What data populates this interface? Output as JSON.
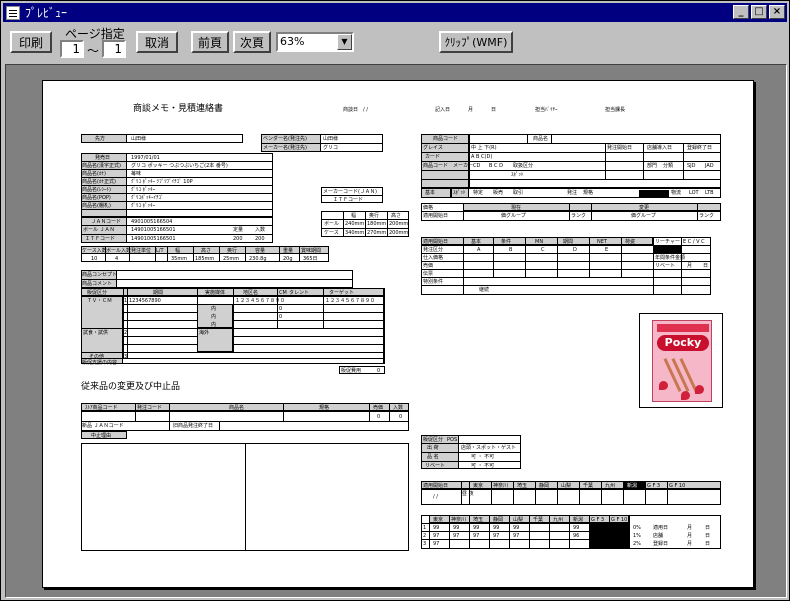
{
  "window": {
    "title": "ﾌﾟﾚﾋﾞｭｰ",
    "min": "_",
    "max": "□",
    "close": "×"
  },
  "toolbar": {
    "print": "印刷",
    "page_select_label": "ページ指定",
    "page_from": "1",
    "page_sep": "～",
    "page_to": "1",
    "cancel": "取消",
    "prev": "前頁",
    "next": "次頁",
    "zoom": "63%",
    "clip": "ｸﾘｯﾌﾟ(WMF)"
  },
  "doc": {
    "title": "商談メモ・見積連絡書",
    "sub_title": "従来品の変更及び中止品",
    "h_date": "商談日",
    "h_slash": "/     /",
    "h_creator": "記入日",
    "h_month": "月",
    "h_day": "日",
    "h_buyer": "担当ﾊﾞｲﾔｰ",
    "h_charge": "担当課長",
    "f_maker": "先方",
    "f_maker_val": "山田様",
    "f_vendor": "ベンダー名(発注先)",
    "f_vendor_val": "山田様",
    "f_maker2": "メーカー名(発注先)",
    "f_maker2_val": "グリコ",
    "f_ship": "発売日",
    "f_ship_val": "1997/01/01",
    "f_item": "商品名(漢字正式)",
    "f_item_val": "グリコ ポッキー つぶつぶいちご(2本 番号)",
    "f_item2": "商品名(ｶﾅ)",
    "f_item2_val": "苺味",
    "f_item3": "商品名(ｶﾅ正式)",
    "f_item3_val": "ｸﾞﾘｺ ﾎﾟｯｷｰ ﾂﾌﾞﾂﾌﾞｲﾁｺﾞ 10P",
    "f_item4": "商品名(ﾚｼｰﾄ)",
    "f_item4_val": "ｸﾞﾘｺ ﾎﾟｯｷｰ",
    "f_item5": "商品名(POP)",
    "f_item5_val": "ｸﾞﾘｺﾎﾟｯｷｰｲﾁｺﾞ",
    "f_item6": "商品名(棚札)",
    "f_item6_val": "ｸﾞﾘｺ ﾎﾟｯｷｰ",
    "f_makercode": "メーカーコード(ＪＡＮ)",
    "f_itf": "ＩＴＦコード",
    "f_jan": "ＪＡＮコード",
    "f_jan_val": "4901005166504",
    "f_jan2": "ボール ＪＡＮ",
    "f_jan2_val": "14901005166501",
    "f_itf2": "ＩＴＦコード",
    "f_itf2_val": "14901005166501",
    "f_w": "幅",
    "f_h": "奥行",
    "f_d": "高さ",
    "f_ball": "ボール",
    "f_case": "ケース",
    "f_v1": "240mm",
    "f_v2": "180mm",
    "f_v3": "200mm",
    "f_v4": "340mm",
    "f_v5": "270mm",
    "f_v6": "200mm",
    "f_count": "定量",
    "f_count2": "入数",
    "f_v7": "200",
    "f_v8": "200",
    "f_case_in": "ケース入数",
    "f_ball_in": "ボール入数",
    "f_order": "発注単位",
    "f_lead": "L/T",
    "f_w2": "幅",
    "f_h2": "高さ",
    "f_d2": "奥行",
    "f_vol": "容量",
    "f_weight": "重量",
    "f_temp": "賞味期間",
    "f_r1": "10",
    "f_r2": "4",
    "f_r3": "35mm",
    "f_r4": "185mm",
    "f_r5": "25mm",
    "f_r6": "230.8g",
    "f_r7": "20g",
    "f_r8": "365日",
    "f_concept": "商品コンセプト",
    "f_comment": "商品コメント",
    "f_ad": "販促区分",
    "f_period": "期間",
    "f_media": "実施媒体",
    "f_place": "地区名",
    "f_cm": "CM",
    "f_talent": "タレント",
    "f_target": "ターゲット",
    "f_tvcm": "ＴＶ・ＣＭ",
    "f_one": "1",
    "f_tv_val": "1234567890",
    "f_tv_val2": "１２３４５６７８９０",
    "f_tv_val3": "１２３４５６７８９０",
    "f_zero": "0",
    "f_in": "内",
    "f_kai": "海外",
    "f_sample": "試食・試供",
    "f_two": "2",
    "f_other": "その他",
    "f_three": "3",
    "f_support": "販促支援の内容",
    "f_cost": "販促費用",
    "f_cost_val": "0",
    "f_sales": "売価",
    "f_sales2": "販売価格",
    "f_cond": "条件",
    "old_code": "ｽﾄｱ商品コード",
    "old_jan": "発注コード",
    "old_name": "商品名",
    "old_price": "規格",
    "old_cnt": "売価",
    "old_cnt2": "入数",
    "old_v1": "0",
    "old_v2": "0",
    "old_jan2": "新品 ＪＡＮコード",
    "old_date": "旧商品発注終了日",
    "old_stop": "中止理由",
    "r_code": "商品コード",
    "r_name": "商品名",
    "r_cat": "グレイス",
    "r_cat2": "中 上 下(R)",
    "r_class": "カード",
    "r_class2": "A B C(D)",
    "r_date1": "発注開始日",
    "r_date2": "店舗導入日",
    "r_date3": "登録終了日",
    "r_sub": "商品コード",
    "r_sub2": "メーカーCD",
    "r_bcd": "B C D",
    "r_change": "取扱区分",
    "r_kind": "区分",
    "r_stock": "在庫",
    "r_dept": "部門",
    "r_class3": "分類",
    "r_sj": "SJD",
    "r_ad": "JAD",
    "r_cut": "Cut",
    "r_ok": "OK",
    "r_shop": "ｽﾎﾟｯﾄ",
    "r_eig": "店舗",
    "r_basic": "基本",
    "r_spot": "ｽﾎﾟｯﾄ",
    "r_tax": "特定",
    "r_sale": "販売",
    "r_trade": "取引",
    "r_ship": "発注",
    "r_size": "規格",
    "r_tcb": "TCB",
    "r_dist": "物流",
    "r_lot": "LOT",
    "r_ltb": "LTB",
    "r_grp": "価格",
    "r_cur": "現在",
    "r_new": "変更",
    "r_eff": "適用開始日",
    "r_grp2": "価グループ",
    "r_grp3": "価グループ",
    "r_rank": "ランク",
    "r_rank2": "ランク",
    "r_start": "適用開始日",
    "r_base": "基本",
    "r_cond": "条件",
    "r_mn": "MN",
    "r_term": "期間",
    "r_net": "NET",
    "r_pkg": "荷姿",
    "r_lease": "リーチャー",
    "r_ec": "E C / V C",
    "r_ab": "A",
    "r_bb": "B",
    "r_cb": "C",
    "r_db": "D",
    "r_eb": "E",
    "r_prod": "発注区分",
    "r_purch": "仕入価格",
    "r_price": "売価",
    "r_book": "伝票",
    "r_reb": "リベート",
    "r_yearcond": "年間条件金額",
    "r_month": "月",
    "r_day": "日",
    "r_spec": "特別条件",
    "r_keep": "継続",
    "r_supply": "有無",
    "p_pos": "販促区分",
    "p_pos2": "POS",
    "p_ad": "出 荷",
    "p_ad2": "店頭・スポット・ゲスト",
    "p_name": "品 名",
    "p_ok": "可 ・ 不可",
    "p_reb": "リベート",
    "p_ok2": "可 ・ 不可",
    "s_start": "適用開始日",
    "s_slash": "/   /",
    "s_mark": "昼 夜",
    "s_east": "東京",
    "s_kana": "神奈川",
    "s_chiba": "埼玉",
    "s_shizu": "静岡",
    "s_yama": "山梨",
    "s_kita": "千葉",
    "s_kyu": "九州",
    "s_nigata": "新潟",
    "s_gf": "G F 3",
    "s_gf2": "G F 10",
    "s_1": "1",
    "s_2": "2",
    "s_3": "3",
    "s_99": "99",
    "s_97": "97",
    "s_96": "96",
    "s_95": "95",
    "s_b1": "0%",
    "s_b2": "1%",
    "s_b3": "2%",
    "s_n1": "適用日",
    "s_n2": "店舗",
    "s_n3": "登録日"
  }
}
